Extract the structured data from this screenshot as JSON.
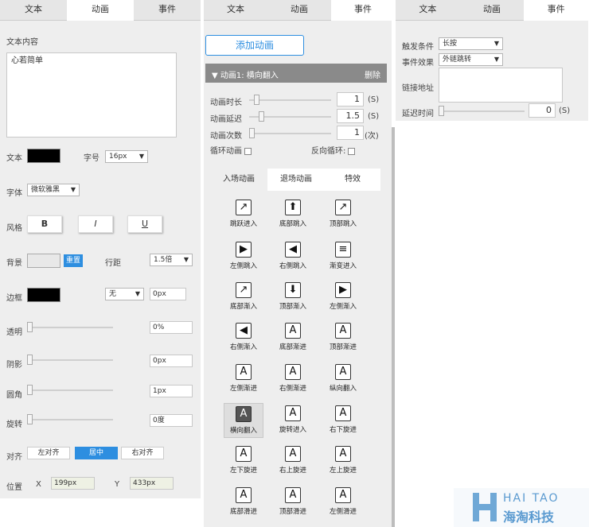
{
  "left": {
    "tabs": [
      "文本",
      "动画",
      "事件"
    ],
    "content_label": "文本内容",
    "content_value": "心若简单",
    "text_label": "文本",
    "fontsize_label": "字号",
    "fontsize_value": "16px",
    "font_label": "字体",
    "font_value": "微软雅黑",
    "style_label": "风格",
    "bold": "B",
    "italic": "I",
    "underline": "U",
    "bg_label": "背景",
    "reset": "重置",
    "lineheight_label": "行距",
    "lineheight_value": "1.5倍",
    "border_label": "边框",
    "border_style": "无",
    "border_width": "0px",
    "opacity_label": "透明",
    "opacity_value": "0%",
    "shadow_label": "阴影",
    "shadow_value": "0px",
    "radius_label": "圆角",
    "radius_value": "1px",
    "rotate_label": "旋转",
    "rotate_value": "0度",
    "align_label": "对齐",
    "align_left": "左对齐",
    "align_center": "居中",
    "align_right": "右对齐",
    "pos_label": "位置",
    "x_label": "X",
    "x_value": "199px",
    "y_label": "Y",
    "y_value": "433px"
  },
  "middle": {
    "tabs": [
      "文本",
      "动画",
      "事件"
    ],
    "add_button": "添加动画",
    "anim_header": "▼ 动画1: 横向翻入",
    "delete": "删除",
    "duration_label": "动画时长",
    "duration_value": "1",
    "delay_label": "动画延迟",
    "delay_value": "1.5",
    "count_label": "动画次数",
    "count_value": "1",
    "unit_s": "(S)",
    "unit_times": "(次)",
    "loop_label": "循环动画",
    "reverse_label": "反向循环:",
    "subtabs": [
      "入场动画",
      "退场动画",
      "特效"
    ],
    "animations": [
      {
        "label": "跳跃进入",
        "icon": "↗",
        "dark": false
      },
      {
        "label": "底部跳入",
        "icon": "⬆",
        "dark": false
      },
      {
        "label": "顶部跳入",
        "icon": "↗",
        "dark": false
      },
      {
        "label": "左侧跳入",
        "icon": "▶",
        "dark": false
      },
      {
        "label": "右侧跳入",
        "icon": "◀",
        "dark": false
      },
      {
        "label": "渐变进入",
        "icon": "≡",
        "dark": false
      },
      {
        "label": "底部渐入",
        "icon": "↗",
        "dark": false
      },
      {
        "label": "顶部渐入",
        "icon": "⬇",
        "dark": false
      },
      {
        "label": "左侧渐入",
        "icon": "▶",
        "dark": false
      },
      {
        "label": "右侧渐入",
        "icon": "◀",
        "dark": false
      },
      {
        "label": "底部渐进",
        "icon": "A",
        "dark": false
      },
      {
        "label": "顶部渐进",
        "icon": "A",
        "dark": false
      },
      {
        "label": "左侧渐进",
        "icon": "A",
        "dark": false
      },
      {
        "label": "右侧渐进",
        "icon": "A",
        "dark": false
      },
      {
        "label": "纵向翻入",
        "icon": "A",
        "dark": false
      },
      {
        "label": "横向翻入",
        "icon": "A",
        "dark": true
      },
      {
        "label": "旋转进入",
        "icon": "A",
        "dark": false
      },
      {
        "label": "右下旋进",
        "icon": "A",
        "dark": false
      },
      {
        "label": "左下旋进",
        "icon": "A",
        "dark": false
      },
      {
        "label": "右上旋进",
        "icon": "A",
        "dark": false
      },
      {
        "label": "左上旋进",
        "icon": "A",
        "dark": false
      },
      {
        "label": "底部滑进",
        "icon": "A",
        "dark": false
      },
      {
        "label": "顶部滑进",
        "icon": "A",
        "dark": false
      },
      {
        "label": "左侧滑进",
        "icon": "A",
        "dark": false
      }
    ]
  },
  "right": {
    "tabs": [
      "文本",
      "动画",
      "事件"
    ],
    "trigger_label": "触发条件",
    "trigger_value": "长按",
    "effect_label": "事件效果",
    "effect_value": "外链跳转",
    "link_label": "链接地址",
    "delay_label": "延迟时间",
    "delay_value": "0",
    "unit_s": "(S)"
  },
  "watermark": {
    "line1": "HAI TAO",
    "line2": "海淘科技"
  },
  "colors": {
    "accent": "#2d8ee0",
    "panel_bg": "#eeeeee",
    "header_bg": "#8a8a8a"
  }
}
